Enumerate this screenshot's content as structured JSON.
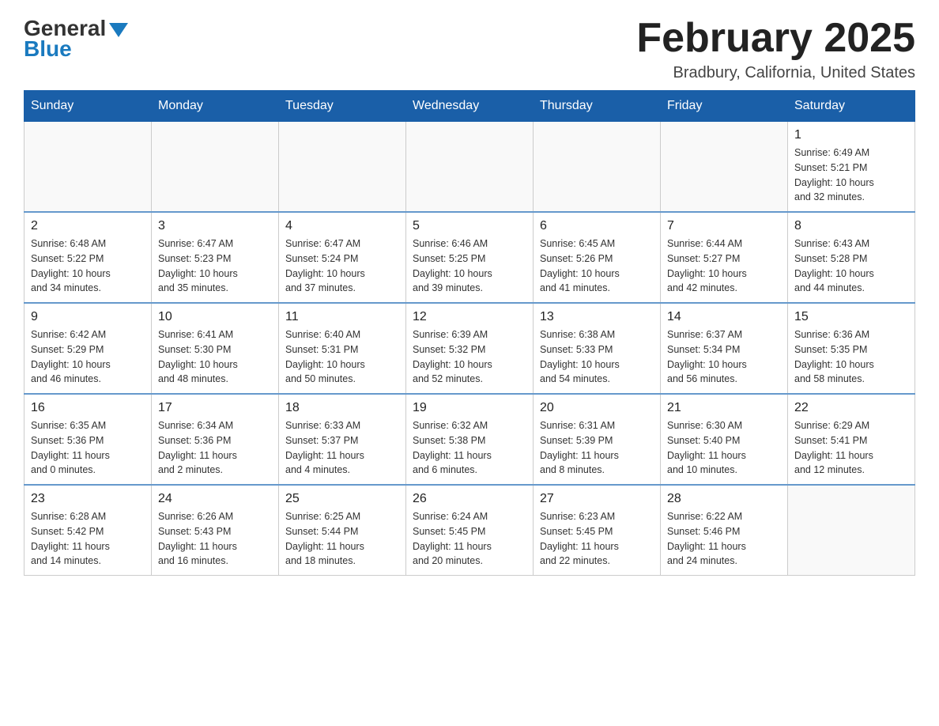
{
  "logo": {
    "general": "General",
    "blue": "Blue"
  },
  "title": "February 2025",
  "location": "Bradbury, California, United States",
  "days_of_week": [
    "Sunday",
    "Monday",
    "Tuesday",
    "Wednesday",
    "Thursday",
    "Friday",
    "Saturday"
  ],
  "weeks": [
    [
      {
        "day": "",
        "info": ""
      },
      {
        "day": "",
        "info": ""
      },
      {
        "day": "",
        "info": ""
      },
      {
        "day": "",
        "info": ""
      },
      {
        "day": "",
        "info": ""
      },
      {
        "day": "",
        "info": ""
      },
      {
        "day": "1",
        "info": "Sunrise: 6:49 AM\nSunset: 5:21 PM\nDaylight: 10 hours\nand 32 minutes."
      }
    ],
    [
      {
        "day": "2",
        "info": "Sunrise: 6:48 AM\nSunset: 5:22 PM\nDaylight: 10 hours\nand 34 minutes."
      },
      {
        "day": "3",
        "info": "Sunrise: 6:47 AM\nSunset: 5:23 PM\nDaylight: 10 hours\nand 35 minutes."
      },
      {
        "day": "4",
        "info": "Sunrise: 6:47 AM\nSunset: 5:24 PM\nDaylight: 10 hours\nand 37 minutes."
      },
      {
        "day": "5",
        "info": "Sunrise: 6:46 AM\nSunset: 5:25 PM\nDaylight: 10 hours\nand 39 minutes."
      },
      {
        "day": "6",
        "info": "Sunrise: 6:45 AM\nSunset: 5:26 PM\nDaylight: 10 hours\nand 41 minutes."
      },
      {
        "day": "7",
        "info": "Sunrise: 6:44 AM\nSunset: 5:27 PM\nDaylight: 10 hours\nand 42 minutes."
      },
      {
        "day": "8",
        "info": "Sunrise: 6:43 AM\nSunset: 5:28 PM\nDaylight: 10 hours\nand 44 minutes."
      }
    ],
    [
      {
        "day": "9",
        "info": "Sunrise: 6:42 AM\nSunset: 5:29 PM\nDaylight: 10 hours\nand 46 minutes."
      },
      {
        "day": "10",
        "info": "Sunrise: 6:41 AM\nSunset: 5:30 PM\nDaylight: 10 hours\nand 48 minutes."
      },
      {
        "day": "11",
        "info": "Sunrise: 6:40 AM\nSunset: 5:31 PM\nDaylight: 10 hours\nand 50 minutes."
      },
      {
        "day": "12",
        "info": "Sunrise: 6:39 AM\nSunset: 5:32 PM\nDaylight: 10 hours\nand 52 minutes."
      },
      {
        "day": "13",
        "info": "Sunrise: 6:38 AM\nSunset: 5:33 PM\nDaylight: 10 hours\nand 54 minutes."
      },
      {
        "day": "14",
        "info": "Sunrise: 6:37 AM\nSunset: 5:34 PM\nDaylight: 10 hours\nand 56 minutes."
      },
      {
        "day": "15",
        "info": "Sunrise: 6:36 AM\nSunset: 5:35 PM\nDaylight: 10 hours\nand 58 minutes."
      }
    ],
    [
      {
        "day": "16",
        "info": "Sunrise: 6:35 AM\nSunset: 5:36 PM\nDaylight: 11 hours\nand 0 minutes."
      },
      {
        "day": "17",
        "info": "Sunrise: 6:34 AM\nSunset: 5:36 PM\nDaylight: 11 hours\nand 2 minutes."
      },
      {
        "day": "18",
        "info": "Sunrise: 6:33 AM\nSunset: 5:37 PM\nDaylight: 11 hours\nand 4 minutes."
      },
      {
        "day": "19",
        "info": "Sunrise: 6:32 AM\nSunset: 5:38 PM\nDaylight: 11 hours\nand 6 minutes."
      },
      {
        "day": "20",
        "info": "Sunrise: 6:31 AM\nSunset: 5:39 PM\nDaylight: 11 hours\nand 8 minutes."
      },
      {
        "day": "21",
        "info": "Sunrise: 6:30 AM\nSunset: 5:40 PM\nDaylight: 11 hours\nand 10 minutes."
      },
      {
        "day": "22",
        "info": "Sunrise: 6:29 AM\nSunset: 5:41 PM\nDaylight: 11 hours\nand 12 minutes."
      }
    ],
    [
      {
        "day": "23",
        "info": "Sunrise: 6:28 AM\nSunset: 5:42 PM\nDaylight: 11 hours\nand 14 minutes."
      },
      {
        "day": "24",
        "info": "Sunrise: 6:26 AM\nSunset: 5:43 PM\nDaylight: 11 hours\nand 16 minutes."
      },
      {
        "day": "25",
        "info": "Sunrise: 6:25 AM\nSunset: 5:44 PM\nDaylight: 11 hours\nand 18 minutes."
      },
      {
        "day": "26",
        "info": "Sunrise: 6:24 AM\nSunset: 5:45 PM\nDaylight: 11 hours\nand 20 minutes."
      },
      {
        "day": "27",
        "info": "Sunrise: 6:23 AM\nSunset: 5:45 PM\nDaylight: 11 hours\nand 22 minutes."
      },
      {
        "day": "28",
        "info": "Sunrise: 6:22 AM\nSunset: 5:46 PM\nDaylight: 11 hours\nand 24 minutes."
      },
      {
        "day": "",
        "info": ""
      }
    ]
  ]
}
